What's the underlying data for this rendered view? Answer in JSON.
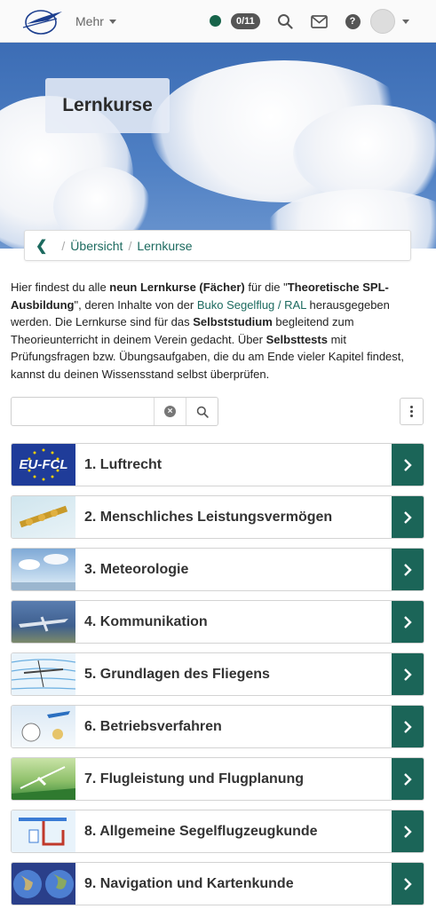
{
  "nav": {
    "more_label": "Mehr",
    "score_badge": "0/11",
    "status_color": "#17644a",
    "icons": [
      "club-logo-icon",
      "search-icon",
      "mail-icon",
      "help-icon",
      "avatar"
    ],
    "help_glyph": "?"
  },
  "hero": {
    "title": "Lernkurse"
  },
  "breadcrumb": {
    "back_glyph": "❮",
    "items": [
      "Übersicht",
      "Lernkurse"
    ]
  },
  "intro": {
    "p1": "Hier findest du alle ",
    "b1": "neun Lernkurse (Fächer)",
    "p2": " für die \"",
    "b2": "Theoretische SPL-Ausbildung",
    "p3": "\", deren Inhalte von der ",
    "link": "Buko Segelflug / RAL",
    "p4": " herausgegeben werden. Die Lernkurse sind für das ",
    "b3": "Selbststudium",
    "p5": " begleitend zum Theorieunterricht in deinem Verein gedacht. Über ",
    "b4": "Selbsttests",
    "p6": " mit Prüfungsfragen bzw. Übungsaufgaben, die du am Ende vieler Kapitel findest, kannst du deinen Wissensstand selbst überprüfen."
  },
  "search": {
    "value": "",
    "placeholder": ""
  },
  "courses": [
    {
      "title": "1. Luftrecht",
      "thumb": "eu-fcl-logo",
      "thumb_text": "EU-FCL"
    },
    {
      "title": "2. Menschliches Leistungsvermögen",
      "thumb": "human-performance-image"
    },
    {
      "title": "3. Meteorologie",
      "thumb": "meteorology-image"
    },
    {
      "title": "4. Kommunikation",
      "thumb": "communication-image"
    },
    {
      "title": "5. Grundlagen des Fliegens",
      "thumb": "principles-of-flight-image"
    },
    {
      "title": "6. Betriebsverfahren",
      "thumb": "operational-procedures-image"
    },
    {
      "title": "7. Flugleistung und Flugplanung",
      "thumb": "flight-planning-image"
    },
    {
      "title": "8. Allgemeine Segelflugzeugkunde",
      "thumb": "aircraft-knowledge-image"
    },
    {
      "title": "9. Navigation und Kartenkunde",
      "thumb": "navigation-globe-image"
    }
  ],
  "colors": {
    "accent": "#1b6558",
    "link": "#1c6a5f"
  }
}
